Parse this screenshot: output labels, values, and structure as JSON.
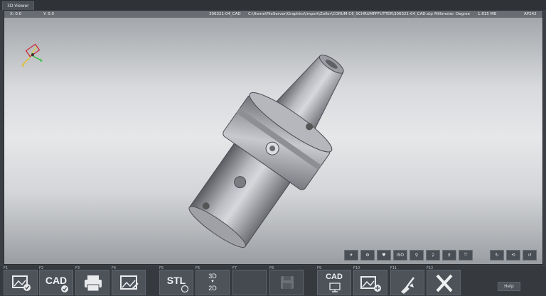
{
  "window": {
    "tab_label": "3D-Viewer"
  },
  "status": {
    "x": "X: 0.0",
    "y": "Y: 0.0",
    "model_name": "306321-04_CAD",
    "file_path": "C:\\Home\\FileServer\\Graphics\\Import\\Zoller\\CORUM-C6_SCHRUMPFFUTTER\\306321-04_CAD.stp",
    "unit": "Millimeter",
    "angle_unit": "Degree",
    "file_size": "1.815 MB",
    "format": "AP242"
  },
  "view_buttons": [
    {
      "name": "view-front-icon"
    },
    {
      "name": "view-rotate-icon"
    },
    {
      "name": "view-top-icon"
    },
    {
      "label": "ISO"
    },
    {
      "name": "view-x-icon"
    },
    {
      "name": "view-y-icon"
    },
    {
      "name": "view-z-icon"
    },
    {
      "name": "fit-view-icon"
    },
    {
      "name": "rotate-x-icon"
    },
    {
      "name": "rotate-y-icon"
    },
    {
      "name": "rotate-reset-icon"
    }
  ],
  "function_keys": [
    {
      "key": "F1",
      "label": "",
      "icon": "image-check-icon"
    },
    {
      "key": "F2",
      "label": "CAD",
      "icon": "cad-check-icon"
    },
    {
      "key": "F3",
      "label": "",
      "icon": "printer-icon"
    },
    {
      "key": "F4",
      "label": "",
      "icon": "image-edit-icon"
    },
    {
      "key": "F5",
      "label": "STL",
      "icon": "stl-icon"
    },
    {
      "key": "F6",
      "label_top": "3D",
      "label_bottom": "2D",
      "icon": "3d-to-2d-icon"
    },
    {
      "key": "F7",
      "label": "",
      "icon": "blank"
    },
    {
      "key": "F8",
      "label": "",
      "icon": "save-icon"
    },
    {
      "key": "F9",
      "label": "CAD",
      "icon": "cad-monitor-icon"
    },
    {
      "key": "F10",
      "label": "",
      "icon": "image-add-icon"
    },
    {
      "key": "F11",
      "label": "",
      "icon": "clean-icon"
    },
    {
      "key": "F12",
      "label": "",
      "icon": "close-icon"
    }
  ],
  "help_label": "Help"
}
